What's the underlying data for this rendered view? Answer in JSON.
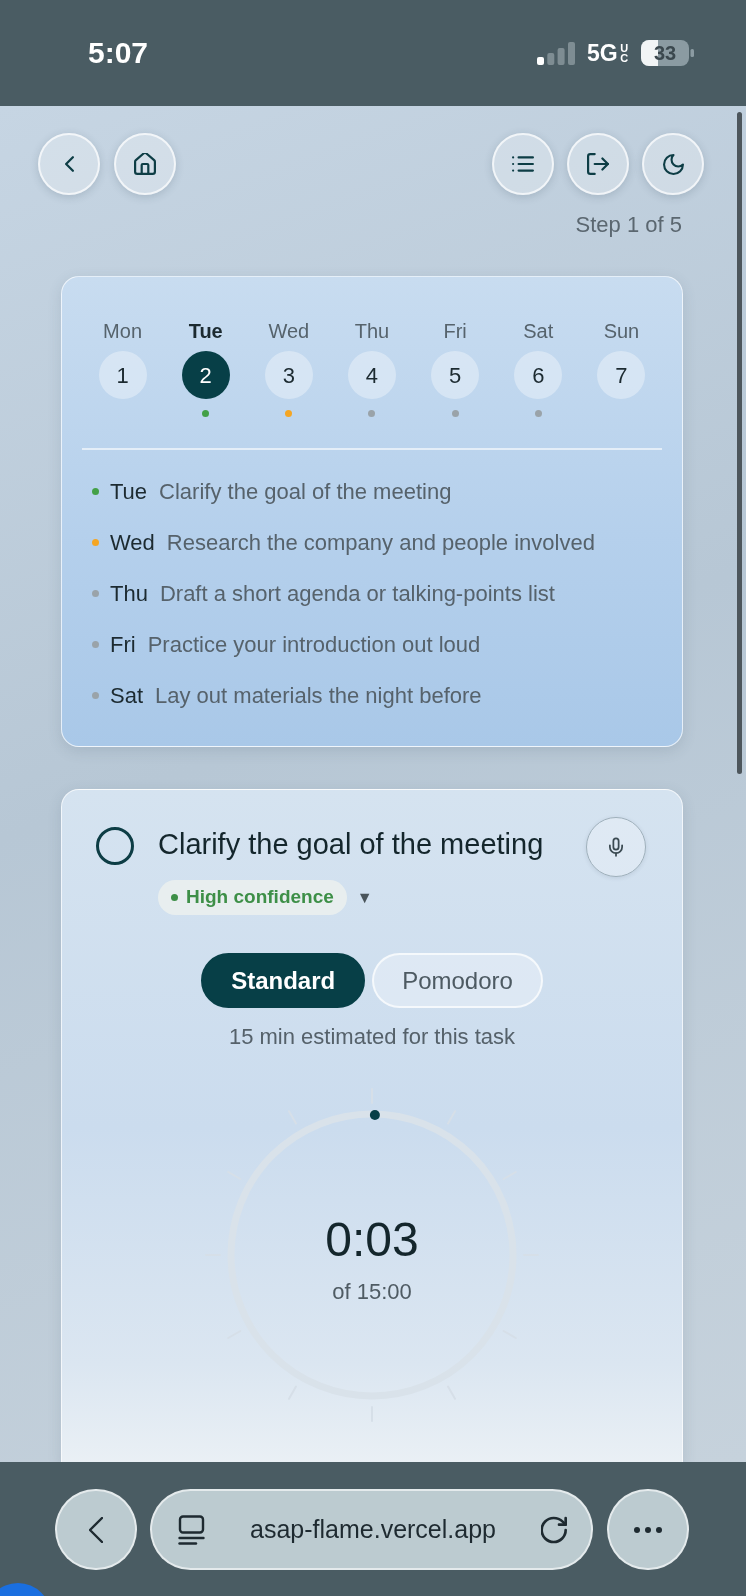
{
  "status_bar": {
    "time": "5:07",
    "network": "5G",
    "network_badge": "UC",
    "battery": "33"
  },
  "header": {
    "step": "Step 1 of 5"
  },
  "week": {
    "days": [
      {
        "name": "Mon",
        "date": "1",
        "selected": false
      },
      {
        "name": "Tue",
        "date": "2",
        "selected": true,
        "color": "#43a047"
      },
      {
        "name": "Wed",
        "date": "3",
        "selected": false,
        "color": "#f5a623"
      },
      {
        "name": "Thu",
        "date": "4",
        "selected": false,
        "color": "#9aa3a9"
      },
      {
        "name": "Fri",
        "date": "5",
        "selected": false,
        "color": "#9aa3a9"
      },
      {
        "name": "Sat",
        "date": "6",
        "selected": false,
        "color": "#9aa3a9"
      },
      {
        "name": "Sun",
        "date": "7",
        "selected": false
      }
    ],
    "plan": [
      {
        "day": "Tue",
        "text": "Clarify the goal of the meeting",
        "color": "#43a047"
      },
      {
        "day": "Wed",
        "text": "Research the company and people involved",
        "color": "#f5a623"
      },
      {
        "day": "Thu",
        "text": "Draft a short agenda or talking-points list",
        "color": "#9aa3a9"
      },
      {
        "day": "Fri",
        "text": "Practice your introduction out loud",
        "color": "#9aa3a9"
      },
      {
        "day": "Sat",
        "text": "Lay out materials the night before",
        "color": "#9aa3a9"
      }
    ]
  },
  "task": {
    "checked": false,
    "title": "Clarify the goal of the meeting",
    "confidence": {
      "label": "High confidence",
      "caret": "▼"
    },
    "modes": [
      {
        "label": "Standard",
        "selected": true
      },
      {
        "label": "Pomodoro",
        "selected": false
      }
    ],
    "estimate": "15 min estimated for this task",
    "timer": {
      "elapsed": "0:03",
      "total": "of 15:00",
      "level": 0.0033
    }
  },
  "browser": {
    "url": "asap-flame.vercel.app"
  }
}
